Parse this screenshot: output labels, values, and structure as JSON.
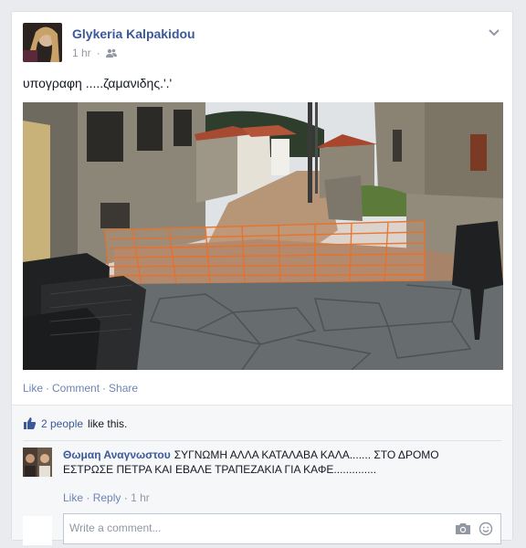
{
  "post": {
    "author": "Glykeria Kalpakidou",
    "time": "1 hr",
    "text": "υπογραφη .....ζαμανιδης.'.'",
    "photo_alt": "Village street with stone houses, orange construction netting across a dirt road, and patio chairs in the foreground"
  },
  "actions": {
    "like": "Like",
    "comment": "Comment",
    "share": "Share",
    "separator": "·"
  },
  "likes": {
    "count": "2 people",
    "suffix": "like this."
  },
  "comment": {
    "author": "Θωμαη Αναγνωστου",
    "text": "ΣΥΓΝΩΜΗ ΑΛΛΑ ΚΑΤΑΛΑΒΑ ΚΑΛΑ....... ΣΤΟ ΔΡΟΜΟ ΕΣΤΡΩΣΕ ΠΕΤΡΑ ΚΑΙ ΕΒΑΛΕ ΤΡΑΠΕΖΑΚΙΑ ΓΙΑ ΚΑΦΕ..............",
    "like": "Like",
    "reply": "Reply",
    "time": "1 hr"
  },
  "write_comment": {
    "placeholder": "Write a comment..."
  },
  "colors": {
    "link": "#3b5998",
    "muted": "#9197a3",
    "background": "#e9ebee",
    "netting": "#e8722a"
  },
  "icons": {
    "audience": "friends-icon",
    "menu": "chevron-down-icon",
    "like": "thumbs-up-icon",
    "camera": "camera-icon",
    "emoji": "smiley-icon"
  }
}
